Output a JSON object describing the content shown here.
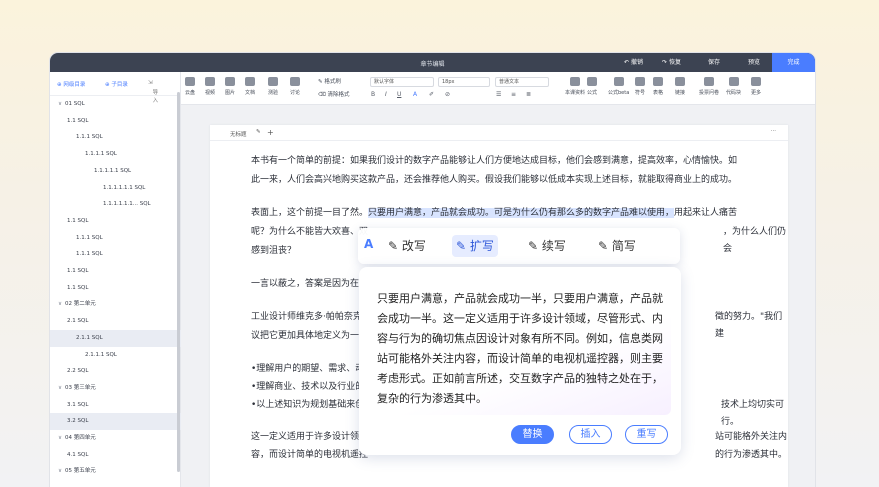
{
  "titlebar": {
    "title": "章节编辑",
    "undo": "撤销",
    "redo": "恢复",
    "save": "保存",
    "preview": "预览",
    "done": "完成"
  },
  "sidebar": {
    "add_outline": "⊕ 网级目录",
    "add_sub": "⊕ 子目录",
    "import": "导入",
    "items": [
      {
        "label": "01 SQL",
        "indent": 0,
        "caret": "∨"
      },
      {
        "label": "1.1 SQL",
        "indent": 1
      },
      {
        "label": "1.1.1 SQL",
        "indent": 2
      },
      {
        "label": "1.1.1.1 SQL",
        "indent": 3
      },
      {
        "label": "1.1.1.1.1 SQL",
        "indent": 4
      },
      {
        "label": "1.1.1.1.1.1 SQL",
        "indent": 5
      },
      {
        "label": "1.1.1.1.1.1... SQL",
        "indent": 5
      },
      {
        "label": "1.1 SQL",
        "indent": 1
      },
      {
        "label": "1.1.1 SQL",
        "indent": 2
      },
      {
        "label": "1.1.1 SQL",
        "indent": 2
      },
      {
        "label": "1.1 SQL",
        "indent": 1
      },
      {
        "label": "1.1 SQL",
        "indent": 1
      },
      {
        "label": "02 第二单元",
        "indent": 0,
        "caret": "∨"
      },
      {
        "label": "2.1 SQL",
        "indent": 1
      },
      {
        "label": "2.1.1 SQL",
        "indent": 2,
        "selected": true
      },
      {
        "label": "2.1.1.1 SQL",
        "indent": 3
      },
      {
        "label": "2.2 SQL",
        "indent": 1
      },
      {
        "label": "03 第三单元",
        "indent": 0,
        "caret": "∨"
      },
      {
        "label": "3.1 SQL",
        "indent": 1
      },
      {
        "label": "3.2 SQL",
        "indent": 1,
        "selected": true
      },
      {
        "label": "04 第四单元",
        "indent": 0,
        "caret": "∨"
      },
      {
        "label": "4.1 SQL",
        "indent": 1
      },
      {
        "label": "05 第五单元",
        "indent": 0,
        "caret": "∨"
      }
    ]
  },
  "toolbar": {
    "tools": [
      {
        "label": "云盘"
      },
      {
        "label": "视频"
      },
      {
        "label": "图片"
      },
      {
        "label": "文档"
      },
      {
        "label": "测验"
      },
      {
        "label": "讨论"
      }
    ],
    "format_brush": "格式刷",
    "clear_format": "清除格式",
    "font": "默认字体",
    "size": "18px",
    "style": "普通文本",
    "tools2": [
      {
        "label": "本课资料"
      },
      {
        "label": "公式"
      },
      {
        "label": "公式beta"
      },
      {
        "label": "符号"
      },
      {
        "label": "表格"
      },
      {
        "label": "链接"
      },
      {
        "label": "投票问卷"
      },
      {
        "label": "代码块"
      },
      {
        "label": "更多"
      }
    ]
  },
  "editor": {
    "tab": "无标题",
    "p1a": "本书有一个简单的前提：如果我们设计的数字产品能够让人们方便地达成目标，他们会感到满意，提高效率，心情愉快。如",
    "p1b": "此一来，人们会高兴地购买这款产品，还会推荐他人购买。假设我们能够以低成本实现上述目标，就能取得商业上的成功。",
    "p2a_pre": "表面上，这个前提一目了然。",
    "p2a_hl": "只要用户满意，产品就会成功。可是为什么仍有那么多的数字产品难以使用，",
    "p2a_post": "用起来让人痛苦",
    "p2b": "呢？为什么不能皆大欢喜、双",
    "p2b_end": "，为什么人们仍会",
    "p2c": "感到沮丧？",
    "p3": "一言以蔽之，答案是因为在产",
    "p4a": "工业设计师维克多·帕帕奈克",
    "p4a_end": "徵的努力。\"我们建",
    "p4b": "议把它更加具体地定义为一种",
    "p5": "•理解用户的期望、需求、动机",
    "p6": "•理解商业、技术以及行业的机",
    "p7": "•以上述知识为规划基础来创造",
    "p7_end": "技术上均切实可行。",
    "p8a": "这一定义适用于许多设计领域",
    "p8a_end": "站可能格外关注内",
    "p8b": "容，而设计简单的电视机遥控",
    "p8b_end": "的行为渗透其中。"
  },
  "ai": {
    "options": [
      {
        "label": "改写"
      },
      {
        "label": "扩写"
      },
      {
        "label": "续写"
      },
      {
        "label": "简写"
      }
    ],
    "text": "只要用户满意，产品就会成功一半，只要用户满意，产品就会成功一半。这一定义适用于许多设计领域，尽管形式、内容与行为的确切焦点因设计对象有所不同。例如，信息类网站可能格外关注内容，而设计简单的电视机遥控器，则主要考虑形式。正如前言所述，交互数字产品的独特之处在于，复杂的行为渗透其中。",
    "replace": "替换",
    "insert": "插入",
    "rewrite": "重写"
  }
}
